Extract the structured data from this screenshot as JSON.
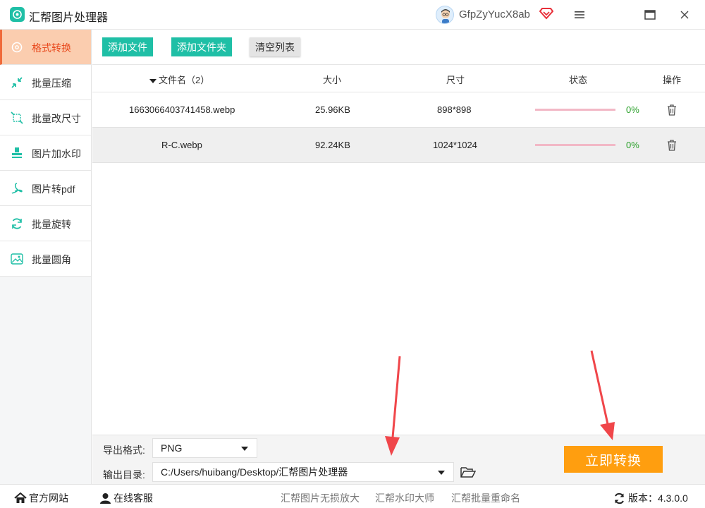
{
  "app": {
    "title": "汇帮图片处理器",
    "username": "GfpZyYucX8ab"
  },
  "sidebar": {
    "items": [
      {
        "label": "格式转换",
        "icon": "format-convert-icon",
        "active": true
      },
      {
        "label": "批量压缩",
        "icon": "compress-icon"
      },
      {
        "label": "批量改尺寸",
        "icon": "resize-icon"
      },
      {
        "label": "图片加水印",
        "icon": "watermark-icon"
      },
      {
        "label": "图片转pdf",
        "icon": "pdf-icon"
      },
      {
        "label": "批量旋转",
        "icon": "rotate-icon"
      },
      {
        "label": "批量圆角",
        "icon": "rounded-corner-icon"
      }
    ]
  },
  "toolbar": {
    "add_file": "添加文件",
    "add_folder": "添加文件夹",
    "clear_list": "清空列表"
  },
  "table": {
    "headers": {
      "name": "文件名（2）",
      "size": "大小",
      "dimension": "尺寸",
      "status": "状态",
      "action": "操作"
    },
    "rows": [
      {
        "name": "1663066403741458.webp",
        "size": "25.96KB",
        "dimension": "898*898",
        "progress": "0%"
      },
      {
        "name": "R-C.webp",
        "size": "92.24KB",
        "dimension": "1024*1024",
        "progress": "0%"
      }
    ]
  },
  "settings": {
    "format_label": "导出格式:",
    "format_value": "PNG",
    "output_label": "输出目录:",
    "output_value": "C:/Users/huibang/Desktop/汇帮图片处理器",
    "convert_button": "立即转换"
  },
  "footer": {
    "website": "官方网站",
    "service": "在线客服",
    "links": [
      "汇帮图片无损放大",
      "汇帮水印大师",
      "汇帮批量重命名"
    ],
    "version": "版本：4.3.0.0"
  },
  "colors": {
    "accent": "#1fbfa6",
    "active_bg": "#fbcdaf",
    "active_text": "#e8481c",
    "convert": "#ff9e0f",
    "arrow": "#f0464a"
  }
}
